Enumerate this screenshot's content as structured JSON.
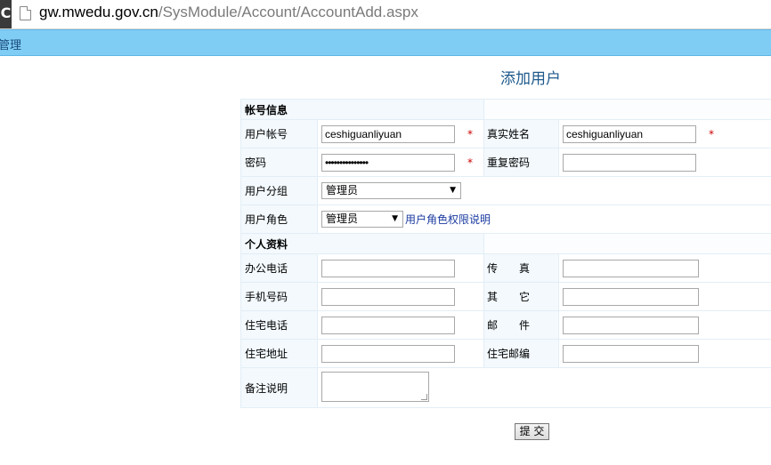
{
  "browser": {
    "url_host": "gw.mwedu.gov.cn",
    "url_path": "/SysModule/Account/AccountAdd.aspx"
  },
  "appbar": {
    "label": "管理"
  },
  "page_title": "添加用户",
  "sections": {
    "account": "帐号信息",
    "profile": "个人资料"
  },
  "fields": {
    "username": {
      "label": "用户帐号",
      "value": "ceshiguanliyuan"
    },
    "realname": {
      "label": "真实姓名",
      "value": "ceshiguanliyuan"
    },
    "password": {
      "label": "密码",
      "value": "•••••••••••••••"
    },
    "password_confirm": {
      "label": "重复密码",
      "value": ""
    },
    "group": {
      "label": "用户分组",
      "selected": "管理员"
    },
    "role": {
      "label": "用户角色",
      "selected": "管理员",
      "link": "用户角色权限说明"
    },
    "office_phone": {
      "label": "办公电话",
      "value": ""
    },
    "fax": {
      "label": "传　　真",
      "value": ""
    },
    "mobile": {
      "label": "手机号码",
      "value": ""
    },
    "other": {
      "label": "其　　它",
      "value": ""
    },
    "home_phone": {
      "label": "住宅电话",
      "value": ""
    },
    "email": {
      "label": "邮　　件",
      "value": ""
    },
    "address": {
      "label": "住宅地址",
      "value": ""
    },
    "zipcode": {
      "label": "住宅邮编",
      "value": ""
    },
    "notes": {
      "label": "备注说明",
      "value": ""
    }
  },
  "required_mark": "*",
  "submit_label": "提 交",
  "colors": {
    "appbar": "#7fcdf5",
    "title": "#1f5a8c",
    "label_bg": "#f3f9fd",
    "required": "#cc0000",
    "link": "#1a3aa0"
  }
}
